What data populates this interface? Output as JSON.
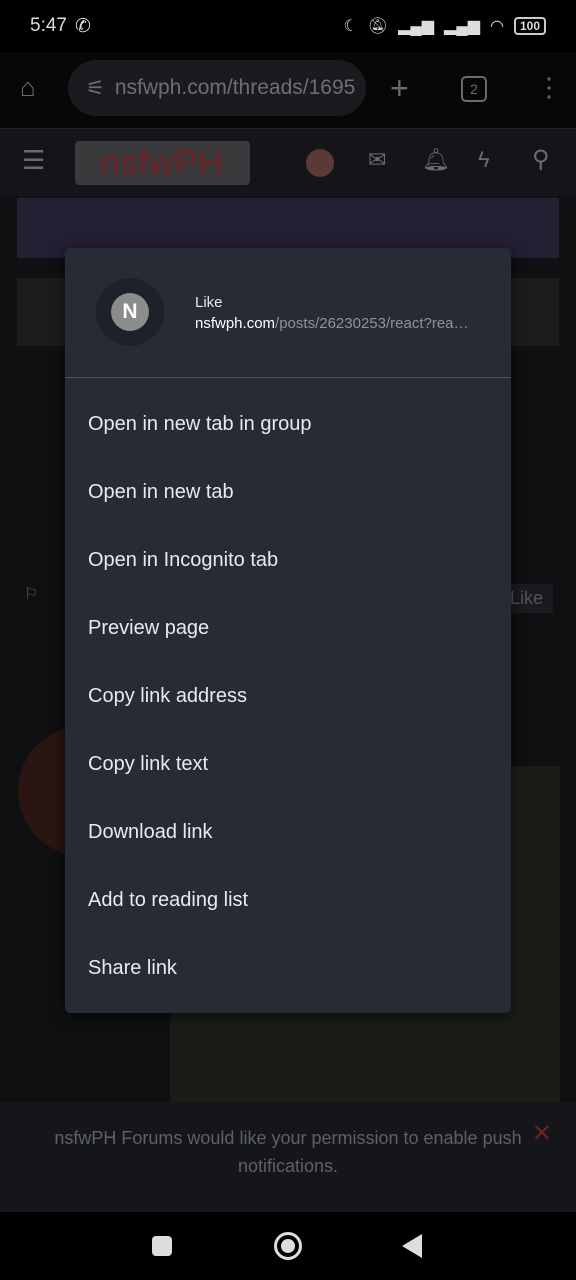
{
  "status_bar": {
    "time": "5:47",
    "battery": "100"
  },
  "browser": {
    "url": "nsfwph.com/threads/1695",
    "tab_count": "2"
  },
  "site": {
    "logo": "nsfwPH",
    "like_label": "Like"
  },
  "context_menu": {
    "link_title": "Like",
    "link_domain": "nsfwph.com",
    "link_path": "/posts/26230253/react?rea…",
    "favicon_letter": "N",
    "items": [
      {
        "label": "Open in new tab in group"
      },
      {
        "label": "Open in new tab"
      },
      {
        "label": "Open in Incognito tab"
      },
      {
        "label": "Preview page"
      },
      {
        "label": "Copy link address"
      },
      {
        "label": "Copy link text"
      },
      {
        "label": "Download link"
      },
      {
        "label": "Add to reading list"
      },
      {
        "label": "Share link"
      }
    ]
  },
  "notification": {
    "text": "nsfwPH Forums would like your permission to enable push notifications.",
    "close": "✕"
  }
}
